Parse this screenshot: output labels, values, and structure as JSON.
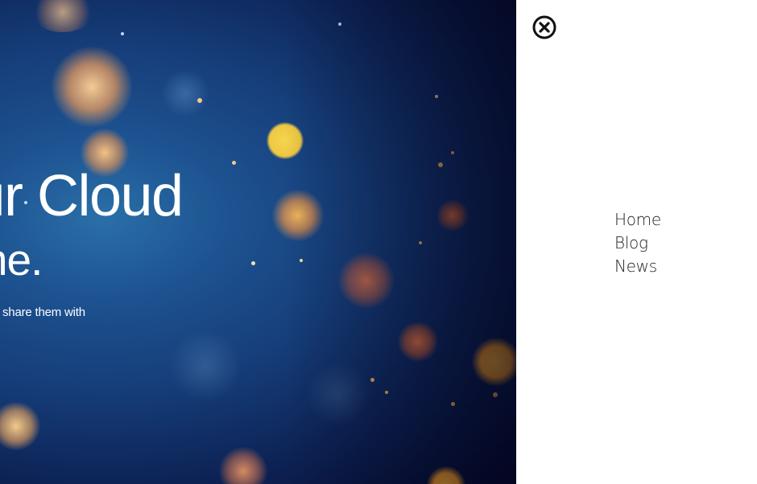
{
  "hero": {
    "title_line1": "Your Cloud",
    "title_line2": "re. Anytime.",
    "subtitle": "ets you access them from anywhere and makes it easy to share them with"
  },
  "menu": {
    "close_icon": "close-circle-icon",
    "items": [
      {
        "label": "Home"
      },
      {
        "label": "Blog"
      },
      {
        "label": "News"
      }
    ]
  },
  "colors": {
    "hero_background": "#163e7a",
    "hero_text": "#ffffff",
    "menu_background": "#ffffff",
    "menu_text": "#1f1f1f",
    "bokeh_warm": "#f6a84a",
    "bokeh_yellow": "#f1d04a"
  }
}
